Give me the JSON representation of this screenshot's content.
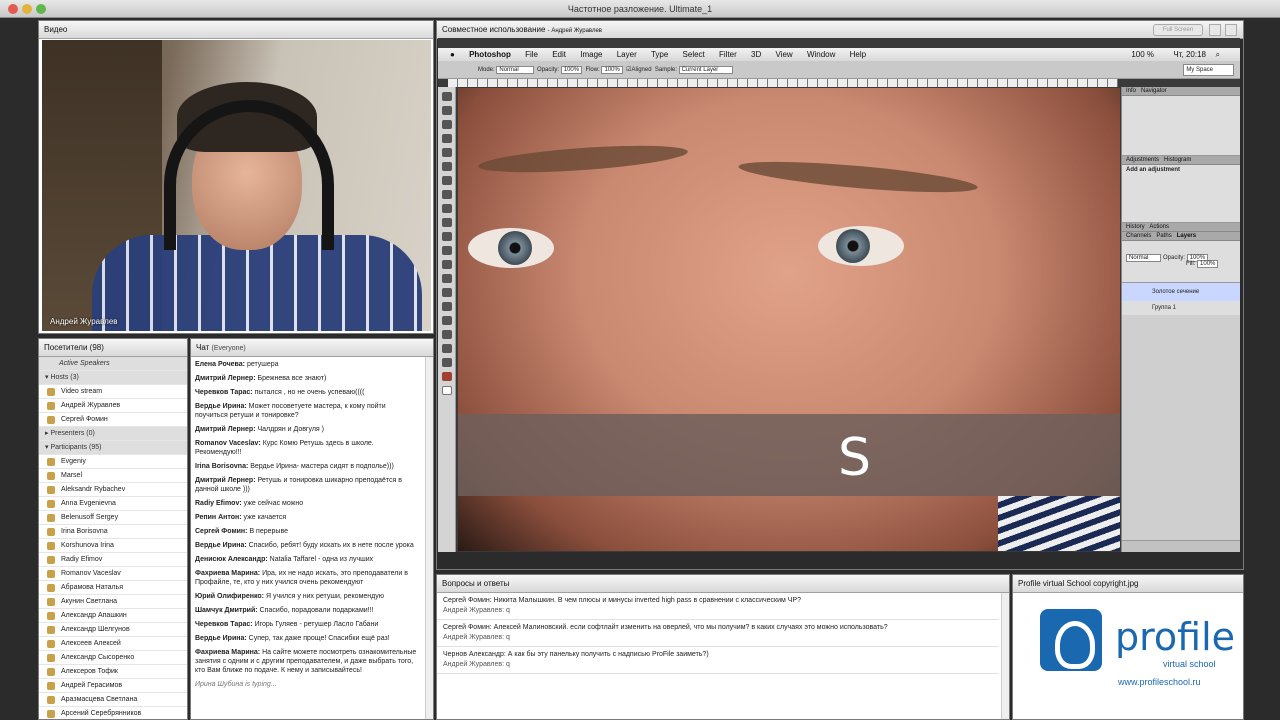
{
  "window": {
    "title": "Частотное разложение. Ultimate_1"
  },
  "video_pod": {
    "title": "Видео",
    "presenter": "Андрей Журавлев"
  },
  "attendees": {
    "title": "Посетители",
    "count": "(98)",
    "active_speakers": "Active Speakers",
    "hosts_label": "Hosts (3)",
    "hosts": [
      "Video stream",
      "Андрей Журавлев",
      "Сергей Фомин"
    ],
    "presenters_label": "Presenters (0)",
    "participants_label": "Participants (95)",
    "participants": [
      "Evgeniy",
      "Marsel",
      "Aleksandr Rybachev",
      "Anna Evgenievna",
      "Belenusoff Sergey",
      "Irina Borisovna",
      "Korshunova Irina",
      "Radiy Efimov",
      "Romanov Vaceslav",
      "Абрамова Наталья",
      "Акунин Светлана",
      "Александр Апашкин",
      "Александр Шелгунов",
      "Алексеев Алексей",
      "Александр Сысоренко",
      "Алексеров Тофик",
      "Андрей Герасимов",
      "Аразмасцева Светлана",
      "Арсений Серебрянников"
    ]
  },
  "chat": {
    "title": "Чат",
    "scope": "(Everyone)",
    "messages": [
      {
        "author": "Елена Рочева:",
        "text": "ретушера"
      },
      {
        "author": "Дмитрий Лернер:",
        "text": "Брежнева все знают)"
      },
      {
        "author": "Черевков Тарас:",
        "text": "пытался , но не очень успеваю(((("
      },
      {
        "author": "Вердье Ирина:",
        "text": "Может посоветуете мастера, к кому пойти поучиться ретуши и тонировке?"
      },
      {
        "author": "Дмитрий Лернер:",
        "text": "Чалдрян и Довгуля )"
      },
      {
        "author": "Romanov Vaceslav:",
        "text": "Курс Комю Ретушь здесь в школе. Рекомендую!!!"
      },
      {
        "author": "Irina Borisovna:",
        "text": "Вердье Ирина- мастера сидят в подполье)))"
      },
      {
        "author": "Дмитрий Лернер:",
        "text": "Ретушь и тонировка шикарно преподаётся в данной школе )))"
      },
      {
        "author": "Radiy Efimov:",
        "text": "уже сейчас можно"
      },
      {
        "author": "Репин Антон:",
        "text": "уже качается"
      },
      {
        "author": "Сергей Фомин:",
        "text": "В перерыве"
      },
      {
        "author": "Вердье Ирина:",
        "text": "Спасибо, ребят! буду искать их в нете после урока"
      },
      {
        "author": "Денисюк Александр:",
        "text": "Natalia Taffarel - одна из лучших"
      },
      {
        "author": "Фахриева Марина:",
        "text": "Ира, их не надо искать, это преподаватели в Профайле, те, кто у них учился очень рекомендуют"
      },
      {
        "author": "Юрий Олифиренко:",
        "text": "Я учился у них ретуши, рекомендую"
      },
      {
        "author": "Шамчук Дмитрий:",
        "text": "Спасибо, порадовали подарками!!!"
      },
      {
        "author": "Черевков Тарас:",
        "text": "Игорь Гуляев - ретушер Ласло Габани"
      },
      {
        "author": "Вердье Ирина:",
        "text": "Супер, так даже проще! Спасибки ещё раз!"
      },
      {
        "author": "Фахриева Марина:",
        "text": "На сайте можете посмотреть ознакомительные занятия с одним и с другим преподавателем, и даже выбрать того, кто Вам ближе по подаче. К нему и записывайтесь!"
      }
    ],
    "typing": "Ирина Шубина is typing..."
  },
  "share_pod": {
    "title": "Совместное использование",
    "owner": "- Андрей Журавлев",
    "fullscreen": "Full Screen"
  },
  "photoshop": {
    "app": "Photoshop",
    "menu": [
      "File",
      "Edit",
      "Image",
      "Layer",
      "Type",
      "Select",
      "Filter",
      "3D",
      "View",
      "Window",
      "Help"
    ],
    "clock": "Чт, 20:18",
    "battery": "100 %",
    "options": {
      "mode_label": "Mode:",
      "mode": "Normal",
      "opacity_label": "Opacity:",
      "opacity": "100%",
      "flow_label": "Flow:",
      "flow": "100%",
      "aligned": "Aligned",
      "sample_label": "Sample:",
      "sample": "Current Layer"
    },
    "workspace": "My Space",
    "overlay_letter": "S",
    "panels": {
      "info_tab": "Info",
      "navigator_tab": "Navigator",
      "adjustments_tab": "Adjustments",
      "histogram_tab": "Histogram",
      "add_adjustment": "Add an adjustment",
      "history_tab": "History",
      "actions_tab": "Actions",
      "channels_tab": "Channels",
      "paths_tab": "Paths",
      "layers_tab": "Layers",
      "blend": "Normal",
      "opacity_label": "Opacity:",
      "opacity": "100%",
      "fill_label": "Fill:",
      "fill": "100%",
      "layers": [
        "Золотое сечение",
        "Группа 1"
      ]
    }
  },
  "qa": {
    "title": "Вопросы и ответы",
    "items": [
      {
        "q": "Сергей Фомин: Никита Малышкин. В чем плюсы и минусы inverted high pass в сравнении с классическим ЧР?",
        "a": "Андрей Журавлев: q"
      },
      {
        "q": "Сергей Фомин: Алексей Малиновский. если софтлайт изменить на оверлей, что мы получим? в каких случаях это можно использовать?",
        "a": "Андрей Журавлев: q"
      },
      {
        "q": "Чернов Александр: А как бы эту панельку получить с надписью ProFile заиметь?)",
        "a": "Андрей Журавлев: q"
      }
    ]
  },
  "profile_pod": {
    "title": "Profile virtual School copyright.jpg",
    "brand": "profile",
    "sub": "virtual school",
    "url": "www.profileschool.ru"
  }
}
